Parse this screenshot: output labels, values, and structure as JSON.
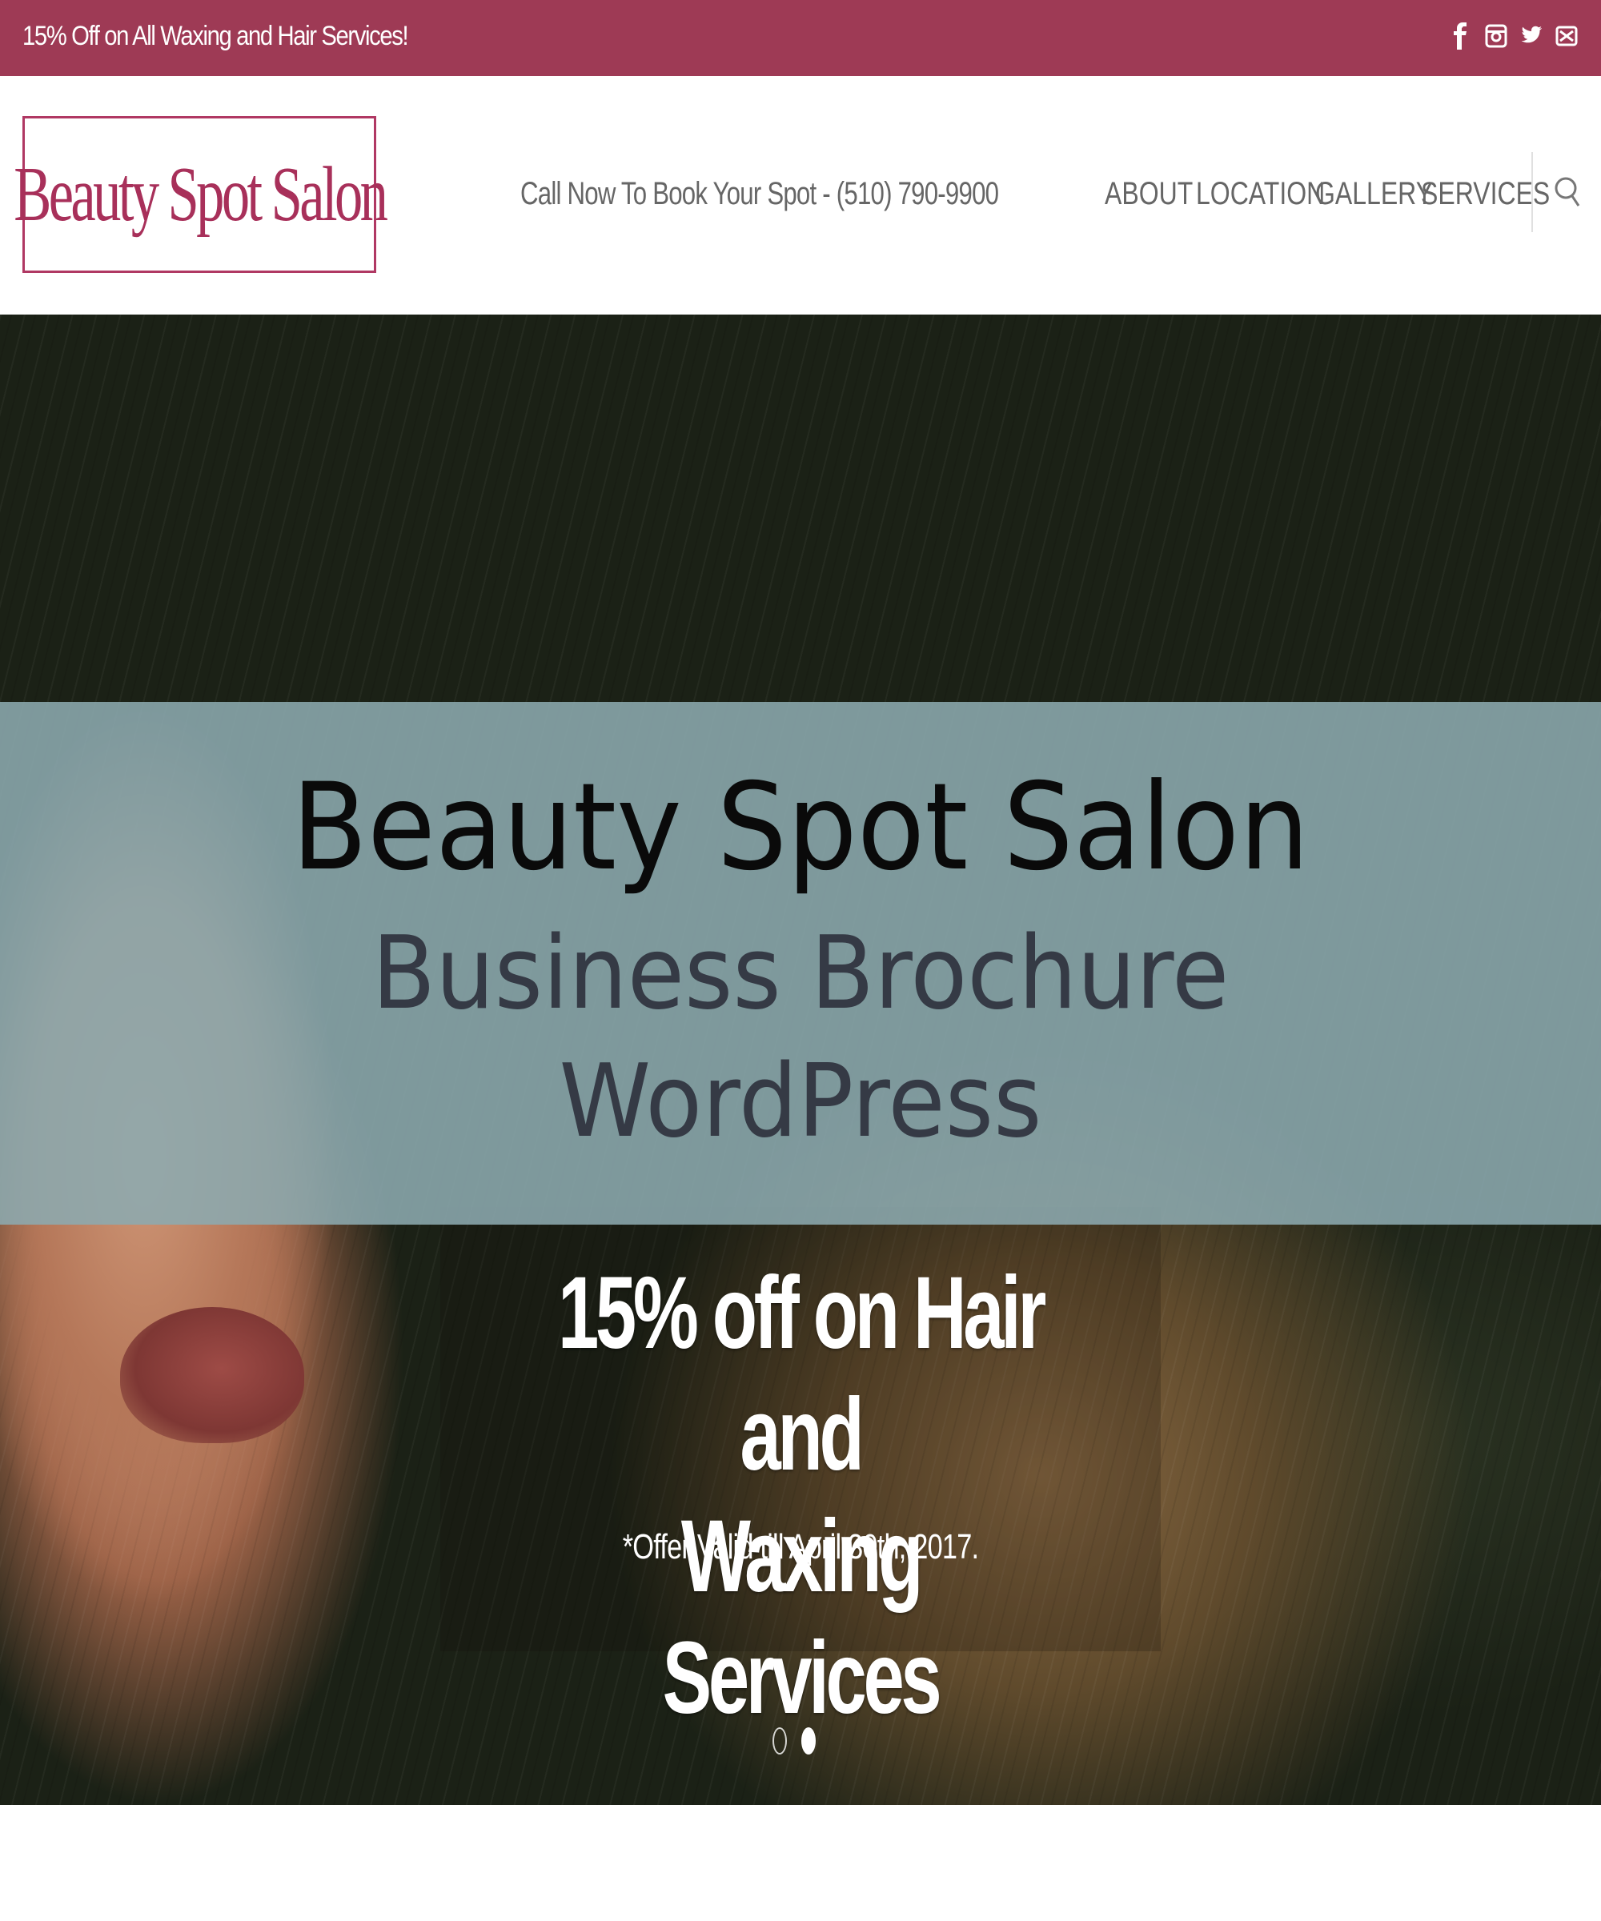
{
  "topbar": {
    "promo": "15% Off on All Waxing and Hair Services!",
    "social_icons": [
      "facebook-icon",
      "instagram-icon",
      "twitter-icon",
      "email-icon"
    ],
    "background": "#9e3a55"
  },
  "header": {
    "logo_text": "Beauty Spot Salon",
    "call_text": "Call Now To Book Your Spot - (510) 790-9900",
    "nav": [
      "ABOUT",
      "LOCATION",
      "GALLERY",
      "SERVICES"
    ],
    "search_icon": "search-icon",
    "brand_color": "#a8305a"
  },
  "overlay": {
    "title": "Beauty Spot Salon",
    "subtitle_line1": "Business Brochure",
    "subtitle_line2": "WordPress",
    "background": "#8caaaf"
  },
  "hero": {
    "promo_lines": [
      "15% off on Hair and",
      "Waxing Services"
    ],
    "note": "*Offer Valid till April 30th, 2017.",
    "slider": {
      "slides": 2,
      "active": 2
    }
  }
}
